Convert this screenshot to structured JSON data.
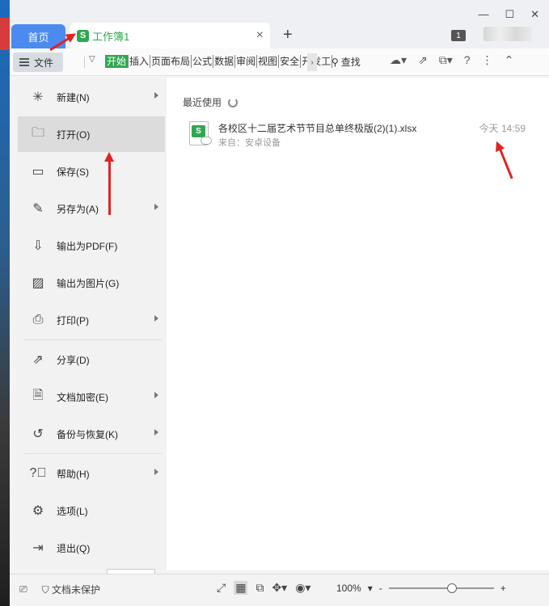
{
  "titlebar": {
    "home_tab": "首页",
    "doc_tab": "工作簿1",
    "doc_tab_icon": "spreadsheet-s-icon",
    "close_icon": "×",
    "new_tab": "+",
    "window_count": "1"
  },
  "ribbon": {
    "file_label": "文件",
    "tabs": [
      "开始",
      "插入",
      "页面布局",
      "公式",
      "数据",
      "审阅",
      "视图",
      "安全",
      "开发工"
    ],
    "active_tab": "开始",
    "search_label": "查找",
    "accent_color": "#2fa84f"
  },
  "file_menu": {
    "items": [
      {
        "label": "新建(N)",
        "icon": "new-file-icon",
        "has_submenu": true
      },
      {
        "label": "打开(O)",
        "icon": "folder-open-icon",
        "has_submenu": false,
        "selected": true
      },
      {
        "label": "保存(S)",
        "icon": "save-icon",
        "has_submenu": false
      },
      {
        "label": "另存为(A)",
        "icon": "save-as-icon",
        "has_submenu": true
      },
      {
        "label": "输出为PDF(F)",
        "icon": "pdf-icon",
        "has_submenu": false
      },
      {
        "label": "输出为图片(G)",
        "icon": "image-icon",
        "has_submenu": false
      },
      {
        "label": "打印(P)",
        "icon": "printer-icon",
        "has_submenu": true
      },
      {
        "label": "分享(D)",
        "icon": "share-icon",
        "has_submenu": false
      },
      {
        "label": "文档加密(E)",
        "icon": "lock-doc-icon",
        "has_submenu": true
      },
      {
        "label": "备份与恢复(K)",
        "icon": "backup-icon",
        "has_submenu": true
      },
      {
        "label": "帮助(H)",
        "icon": "help-icon",
        "has_submenu": true
      },
      {
        "label": "选项(L)",
        "icon": "gear-icon",
        "has_submenu": false
      },
      {
        "label": "退出(Q)",
        "icon": "exit-icon",
        "has_submenu": false
      }
    ]
  },
  "recent": {
    "title": "最近使用",
    "files": [
      {
        "name": "各校区十二届艺术节节目总单终极版(2)(1).xlsx",
        "source": "来自：安卓设备",
        "time": "今天 14:59"
      }
    ]
  },
  "statusbar": {
    "protect_label": "文档未保护",
    "zoom": "100%",
    "zoom_minus": "-",
    "zoom_plus": "+"
  }
}
